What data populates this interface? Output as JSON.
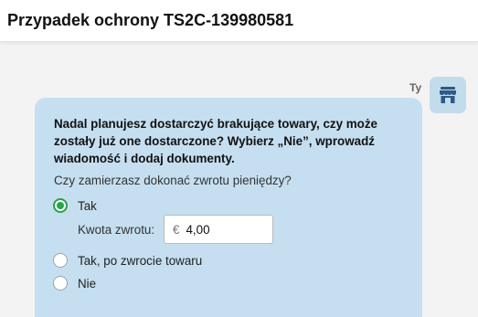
{
  "header": {
    "title": "Przypadek ochrony TS2C-139980581"
  },
  "message": {
    "sender_label": "Ty",
    "avatar_icon": "store-icon",
    "text": "Nadal planujesz dostarczyć brakujące towary, czy może zostały już one dostarczone? Wybierz „Nie”, wprowadź wiadomość i dodaj dokumenty.",
    "question": "Czy zamierzasz dokonać zwrotu pieniędzy?",
    "options": [
      {
        "label": "Tak",
        "selected": true
      },
      {
        "label": "Tak, po zwrocie towaru",
        "selected": false
      },
      {
        "label": "Nie",
        "selected": false
      }
    ],
    "refund": {
      "label": "Kwota zwrotu:",
      "currency_symbol": "€",
      "amount": "4,00"
    }
  },
  "colors": {
    "bubble": "#c5dff0",
    "avatar_bg": "#c3dceb",
    "icon": "#2d5a86",
    "radio_selected": "#27a348"
  }
}
